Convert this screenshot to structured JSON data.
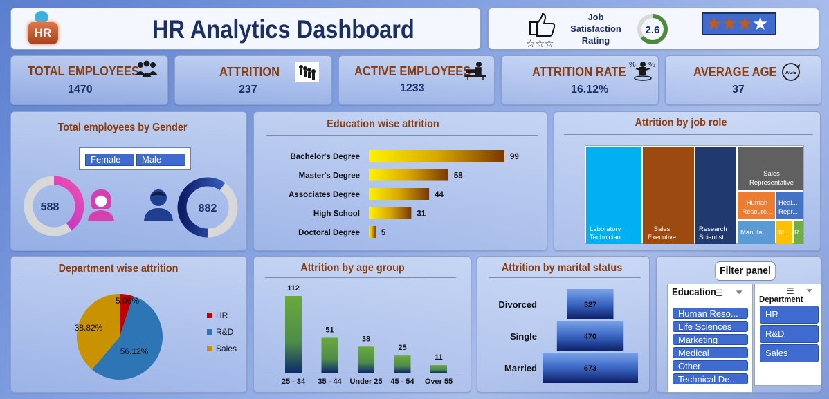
{
  "header": {
    "title": "HR Analytics Dashboard",
    "logo_text": "HR",
    "satisfaction_label_1": "Job",
    "satisfaction_label_2": "Satisfaction",
    "satisfaction_label_3": "Rating",
    "satisfaction_value": "2.6",
    "rating_stars": 3,
    "rating_stars_max": 4
  },
  "kpis": [
    {
      "label": "TOTAL EMPLOYEES",
      "value": "1470",
      "icon": "people-group-icon"
    },
    {
      "label": "ATTRITION",
      "value": "237",
      "icon": "people-exit-icon"
    },
    {
      "label": "ACTIVE EMPLOYEES",
      "value": "1233",
      "icon": "desk-worker-icon"
    },
    {
      "label": "ATTRITION RATE",
      "value": "16.12%",
      "icon": "percent-person-icon"
    },
    {
      "label": "AVERAGE AGE",
      "value": "37",
      "icon": "age-icon"
    }
  ],
  "gender": {
    "title": "Total employees by Gender",
    "filter": [
      "Female",
      "Male"
    ],
    "female_value": "588",
    "male_value": "882"
  },
  "education": {
    "title": "Education wise attrition"
  },
  "jobrole": {
    "title": "Attrition by job role",
    "tiles": [
      "Laboratory Technician",
      "Sales Executive",
      "Research Scientist",
      "Sales Representative",
      "Human Resourc...",
      "Heal... Repr...",
      "Manufa...",
      "M...",
      "R..."
    ]
  },
  "department": {
    "title": "Department wise attrition",
    "legend": [
      "HR",
      "R&D",
      "Sales"
    ]
  },
  "age": {
    "title": "Attrition by age group"
  },
  "marital": {
    "title": "Attrition by marital status"
  },
  "filter_panel": {
    "title": "Filter panel",
    "education_header": "Education",
    "education_items": [
      "Human Reso...",
      "Life Sciences",
      "Marketing",
      "Medical",
      "Other",
      "Technical De..."
    ],
    "department_header": "Department",
    "department_items": [
      "HR",
      "R&D",
      "Sales"
    ]
  },
  "colors": {
    "title_blue": "#1a2f66",
    "accent_brown": "#8b3b0c",
    "female_pink": "#d63fb0",
    "male_navy": "#1e3f8f",
    "slicer_blue": "#3f6bd0"
  },
  "chart_data": [
    {
      "type": "bar",
      "orientation": "horizontal",
      "title": "Education wise attrition",
      "categories": [
        "Bachelor's Degree",
        "Master's Degree",
        "Associates Degree",
        "High School",
        "Doctoral Degree"
      ],
      "values": [
        99,
        58,
        44,
        31,
        5
      ],
      "value_labels": [
        "99",
        "58",
        "44",
        "31",
        "5"
      ],
      "xlim": [
        0,
        99
      ]
    },
    {
      "type": "pie",
      "title": "Department wise attrition",
      "categories": [
        "HR",
        "R&D",
        "Sales"
      ],
      "values": [
        5.06,
        56.12,
        38.82
      ],
      "value_labels": [
        "5.06%",
        "56.12%",
        "38.82%"
      ],
      "colors": [
        "#c00000",
        "#2e75b6",
        "#c89200"
      ],
      "legend": "right"
    },
    {
      "type": "bar",
      "title": "Attrition by age group",
      "categories": [
        "25 - 34",
        "35 - 44",
        "Under 25",
        "45 - 54",
        "Over 55"
      ],
      "values": [
        112,
        51,
        38,
        25,
        11
      ],
      "value_labels": [
        "112",
        "51",
        "38",
        "25",
        "11"
      ],
      "ylim": [
        0,
        112
      ]
    },
    {
      "type": "bar",
      "orientation": "horizontal",
      "title": "Attrition by marital status",
      "categories": [
        "Divorced",
        "Single",
        "Married"
      ],
      "values": [
        327,
        470,
        673
      ],
      "value_labels": [
        "327",
        "470",
        "673"
      ],
      "xlim": [
        0,
        673
      ]
    }
  ]
}
